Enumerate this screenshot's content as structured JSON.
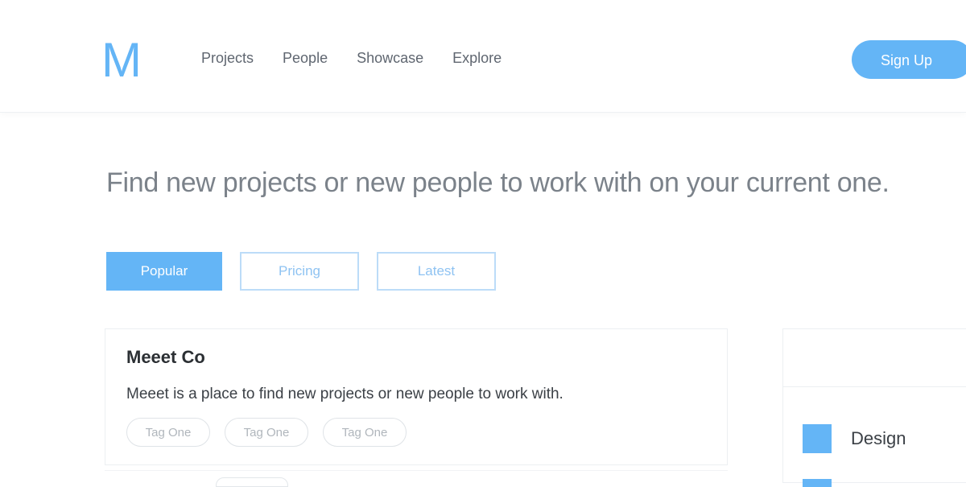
{
  "brand": {
    "logo": "M",
    "accent_color": "#64b5f6"
  },
  "nav": {
    "items": [
      {
        "label": "Projects"
      },
      {
        "label": "People"
      },
      {
        "label": "Showcase"
      },
      {
        "label": "Explore"
      }
    ],
    "signup_label": "Sign Up"
  },
  "hero": {
    "headline": "Find new projects or new people to work with on your current one."
  },
  "filters": {
    "items": [
      {
        "label": "Popular",
        "active": true
      },
      {
        "label": "Pricing",
        "active": false
      },
      {
        "label": "Latest",
        "active": false
      }
    ]
  },
  "projects": [
    {
      "title": "Meeet Co",
      "description": "Meeet is a place to find new projects or new people to work with.",
      "tags": [
        "Tag One",
        "Tag One",
        "Tag One"
      ]
    }
  ],
  "sidebar": {
    "categories": [
      {
        "label": "Design",
        "color": "#64b5f6"
      }
    ]
  }
}
